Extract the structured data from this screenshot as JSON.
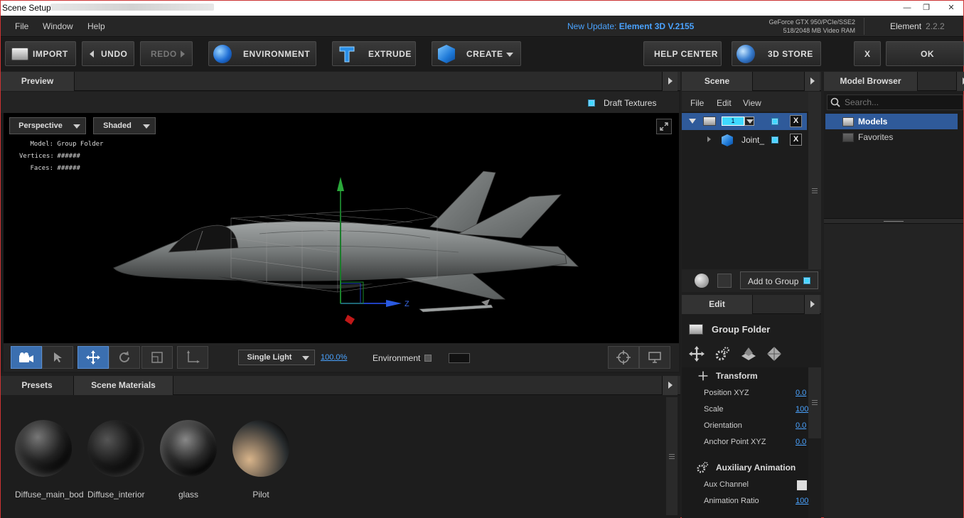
{
  "window": {
    "title": "Scene Setup",
    "minimize": "—",
    "restore": "❐",
    "close": "✕"
  },
  "menu": {
    "file": "File",
    "window": "Window",
    "help": "Help"
  },
  "update": {
    "prefix": "New Update:",
    "version": "Element 3D V.2155"
  },
  "gpu": {
    "line1": "GeForce GTX 950/PCIe/SSE2",
    "line2": "518/2048 MB Video RAM"
  },
  "app": {
    "name": "Element",
    "version": "2.2.2"
  },
  "toolbar": {
    "import": "IMPORT",
    "undo": "UNDO",
    "redo": "REDO",
    "environment": "ENVIRONMENT",
    "extrude": "EXTRUDE",
    "create": "CREATE",
    "help_center": "HELP CENTER",
    "store": "3D STORE",
    "x": "X",
    "ok": "OK"
  },
  "preview": {
    "tab": "Preview",
    "draft_textures": "Draft Textures",
    "camera_mode": "Perspective",
    "render_mode": "Shaded",
    "stats": {
      "model_label": "Model:",
      "model_value": "Group Folder",
      "vertices_label": "Vertices:",
      "vertices_value": "######",
      "faces_label": "Faces:",
      "faces_value": "######"
    },
    "axis_z": "Z",
    "lighting": "Single Light",
    "light_pct": "100.0%",
    "environment": "Environment"
  },
  "presets": {
    "tab_presets": "Presets",
    "tab_materials": "Scene Materials",
    "materials": [
      "Diffuse_main_bod",
      "Diffuse_interior",
      "glass",
      "Pilot"
    ]
  },
  "scene": {
    "tab": "Scene",
    "menu": [
      "File",
      "Edit",
      "View"
    ],
    "group_number": "1",
    "child_name": "Joint_",
    "x": "X",
    "add_to_group": "Add to Group"
  },
  "edit": {
    "tab": "Edit",
    "title": "Group Folder",
    "transform": "Transform",
    "props": [
      {
        "label": "Position XYZ",
        "value": "0.0"
      },
      {
        "label": "Scale",
        "value": "100"
      },
      {
        "label": "Orientation",
        "value": "0.0"
      },
      {
        "label": "Anchor Point XYZ",
        "value": "0.0"
      }
    ],
    "aux": "Auxiliary Animation",
    "aux_channel": "Aux Channel",
    "animation_ratio": "Animation Ratio",
    "animation_ratio_value": "100"
  },
  "model_browser": {
    "tab": "Model Browser",
    "search_placeholder": "Search...",
    "items": [
      "Models",
      "Favorites"
    ]
  },
  "colors": {
    "accent": "#4aa3ff",
    "selection": "#2f5a9a",
    "checkbox": "#3fd9ff"
  }
}
